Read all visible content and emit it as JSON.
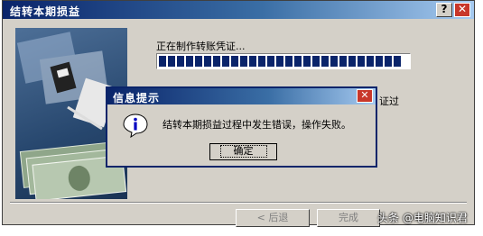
{
  "wizard": {
    "title": "结转本期损益",
    "help_label": "?",
    "close_label": "✕",
    "status_text": "正在制作转账凭证...",
    "progress_fraction": 1.0,
    "side_text": "证过",
    "back_label": "< 后退",
    "finish_label": "完成",
    "watermark": "头条 @电脑知识君",
    "picture": "money-illustration"
  },
  "dialog": {
    "title": "信息提示",
    "close_label": "✕",
    "icon": "info-icon",
    "message": "结转本期损益过程中发生错误，操作失败。",
    "ok_label": "确定"
  },
  "colors": {
    "title_bar": "#0a246a",
    "window_face": "#d4d0c8",
    "progress_fill": "#0a246a",
    "close_button": "#c8372a"
  }
}
